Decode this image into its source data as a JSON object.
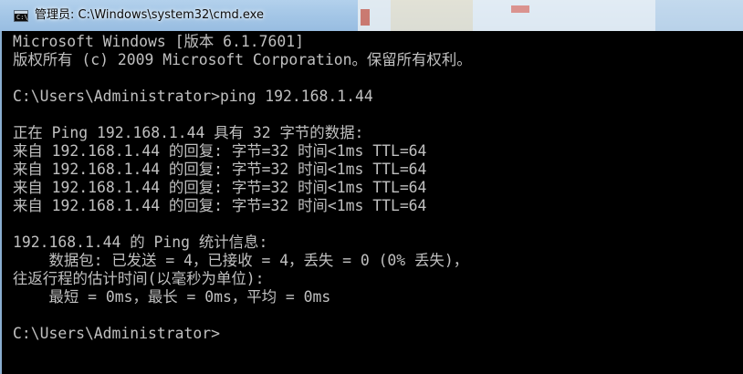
{
  "window": {
    "title": "管理员: C:\\Windows\\system32\\cmd.exe",
    "icon": "cmd-icon",
    "icon_glyph": "C:\\",
    "colors": {
      "console_background": "#000000",
      "console_text": "#c0c0c0",
      "titlebar": "#a5c7e7"
    }
  },
  "console": {
    "lines": [
      "Microsoft Windows [版本 6.1.7601]",
      "版权所有 (c) 2009 Microsoft Corporation。保留所有权利。",
      "",
      "C:\\Users\\Administrator>ping 192.168.1.44",
      "",
      "正在 Ping 192.168.1.44 具有 32 字节的数据:",
      "来自 192.168.1.44 的回复: 字节=32 时间<1ms TTL=64",
      "来自 192.168.1.44 的回复: 字节=32 时间<1ms TTL=64",
      "来自 192.168.1.44 的回复: 字节=32 时间<1ms TTL=64",
      "来自 192.168.1.44 的回复: 字节=32 时间<1ms TTL=64",
      "",
      "192.168.1.44 的 Ping 统计信息:",
      "    数据包: 已发送 = 4，已接收 = 4，丢失 = 0 (0% 丢失)，",
      "往返行程的估计时间(以毫秒为单位):",
      "    最短 = 0ms，最长 = 0ms，平均 = 0ms",
      "",
      "C:\\Users\\Administrator>"
    ]
  }
}
